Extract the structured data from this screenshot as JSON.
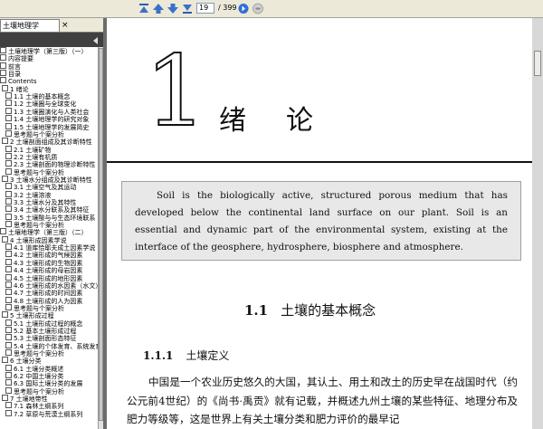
{
  "toolbar": {
    "current_page": "19",
    "total_pages": "/ 399",
    "buttons": [
      "first-page-icon",
      "prev-page-icon",
      "next-page-icon",
      "last-page-icon",
      "go-icon",
      "stop-icon"
    ]
  },
  "tab": {
    "title": "土壤地理学",
    "close": "×"
  },
  "tree": [
    "土壤地理学（第三版）（一）",
    "内容提要",
    "前言",
    "目录",
    "Contents",
    "1  绪论",
    "1.1  土壤的基本概念",
    "1.2  土壤圈与全球变化",
    "1.3  土壤圈演化与人类社会",
    "1.4  土壤地理学的研究对象",
    "1.5  土壤地理学的发展简史",
    "思考题与个案分析",
    "2  土壤剖面组成及其诊断特性",
    "2.1  土壤矿物",
    "2.2  土壤有机质",
    "2.3  土壤剖面的物理诊断特性",
    "思考题与个案分析",
    "3  土壤水分组成及其诊断特性",
    "3.1  土壤空气及其运动",
    "3.2  土壤溶液",
    "3.3  土壤水分及其特性",
    "3.4  土壤水分联系及其特征",
    "3.5  土壤酸与与生态环境联系",
    "思考题与个案分析",
    "土壤地理学（第三版）（二）",
    "4  土壤形成因素学说",
    "4.1  道库恰耶夫成土因素学说",
    "4.2  土壤形成的气候因素",
    "4.3  土壤形成的生物因素",
    "4.4  土壤形成的母岩因素",
    "4.5  土壤形成的地形因素",
    "4.6  土壤形成的水因素（水文）",
    "4.7  土壤形成的时间因素",
    "4.8  土壤形成的人为因素",
    "思考题与个案分析",
    "5  土壤形成过程",
    "5.1  土壤形成过程的概念",
    "5.2  基本土壤形成过程",
    "5.3  土壤剖面形态特征",
    "5.4  土壤的个体发育、系统发育",
    "思考题与个案分析",
    "6  土壤分类",
    "6.1  土壤分类概述",
    "6.2  中国土壤分类",
    "6.3  国际土壤分类的发展",
    "思考题与个案分析",
    "7  土壤地带性",
    "7.1  森林土纲系列",
    "7.2  草原与荒漠土纲系列"
  ],
  "chapter": {
    "number": "1",
    "title": "绪论"
  },
  "abstract": "Soil is the biologically active, structured porous medium that has developed below the continental land surface on our plant. Soil is an essential and dynamic part of the environmental system, existing at the interface of the geosphere, hydrosphere, biosphere and atmosphere.",
  "section": {
    "number": "1.1",
    "title": "土壤的基本概念"
  },
  "subsection": {
    "number": "1.1.1",
    "title": "土壤定义"
  },
  "body": "中国是一个农业历史悠久的大国，其认土、用土和改土的历史早在战国时代（约公元前4世纪）的《尚书·禹贡》就有记载，并概述九州土壤的某些特征、地理分布及肥力等级等，这是世界上有关土壤分类和肥力评价的最早记",
  "colors": {
    "toolbar_bg": "#ece9d8",
    "viewer_bg": "#808080",
    "abstract_bg": "#e8e8e8",
    "sidebar_head": "#404040"
  }
}
